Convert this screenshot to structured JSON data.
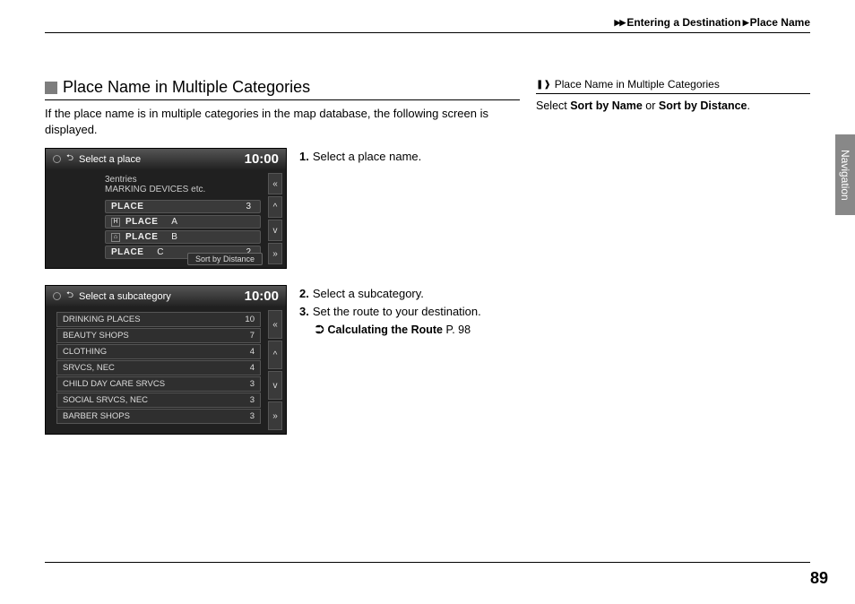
{
  "breadcrumb": {
    "a": "Entering a Destination",
    "b": "Place Name"
  },
  "section": {
    "title": "Place Name in Multiple Categories",
    "intro": "If the place name is in multiple categories in the map database, the following screen is displayed."
  },
  "shot1": {
    "title": "Select a place",
    "clock": "10:00",
    "entries": "3entries",
    "query": "MARKING DEVICES etc.",
    "rows": [
      {
        "icon": "",
        "name": "PLACE",
        "suffix": "",
        "count": "3"
      },
      {
        "icon": "H",
        "name": "PLACE",
        "suffix": "A",
        "count": ""
      },
      {
        "icon": "⌂",
        "name": "PLACE",
        "suffix": "B",
        "count": ""
      },
      {
        "icon": "",
        "name": "PLACE",
        "suffix": "C",
        "count": "2"
      }
    ],
    "sort": "Sort by Distance"
  },
  "shot2": {
    "title": "Select a subcategory",
    "clock": "10:00",
    "rows": [
      {
        "name": "DRINKING PLACES",
        "count": "10"
      },
      {
        "name": "BEAUTY SHOPS",
        "count": "7"
      },
      {
        "name": "CLOTHING",
        "count": "4"
      },
      {
        "name": "SRVCS, NEC",
        "count": "4"
      },
      {
        "name": "CHILD DAY CARE SRVCS",
        "count": "3"
      },
      {
        "name": "SOCIAL SRVCS, NEC",
        "count": "3"
      },
      {
        "name": "BARBER SHOPS",
        "count": "3"
      }
    ]
  },
  "steps": {
    "s1n": "1.",
    "s1": "Select a place name.",
    "s2n": "2.",
    "s2": "Select a subcategory.",
    "s3n": "3.",
    "s3": "Set the route to your destination.",
    "xref_label": "Calculating the Route",
    "xref_page": "P. 98"
  },
  "sidebar": {
    "title": "Place Name in Multiple Categories",
    "text_a": "Select ",
    "text_b": "Sort by Name",
    "text_c": " or ",
    "text_d": "Sort by Distance",
    "text_e": "."
  },
  "tab": "Navigation",
  "page_number": "89"
}
